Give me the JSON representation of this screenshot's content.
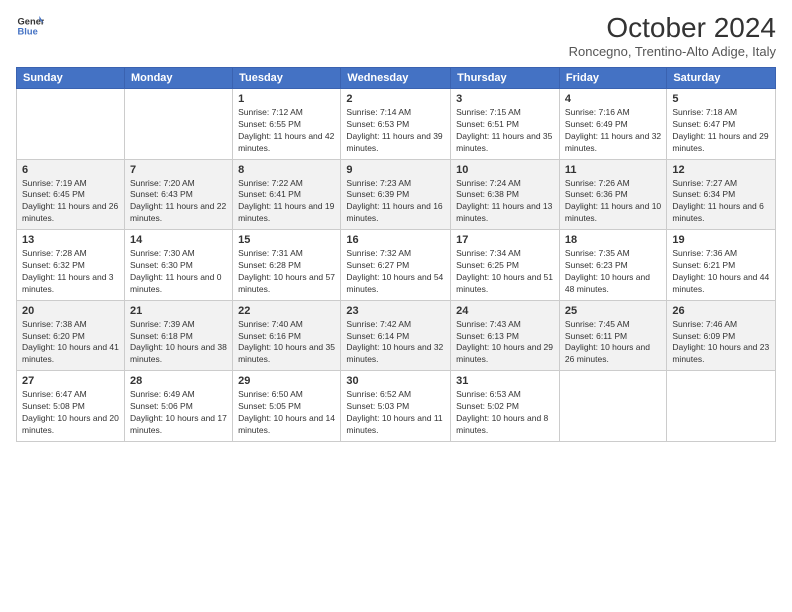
{
  "header": {
    "title": "October 2024",
    "location": "Roncegno, Trentino-Alto Adige, Italy",
    "logo_line1": "General",
    "logo_line2": "Blue"
  },
  "days_of_week": [
    "Sunday",
    "Monday",
    "Tuesday",
    "Wednesday",
    "Thursday",
    "Friday",
    "Saturday"
  ],
  "weeks": [
    [
      {
        "day": "",
        "sunrise": "",
        "sunset": "",
        "daylight": ""
      },
      {
        "day": "",
        "sunrise": "",
        "sunset": "",
        "daylight": ""
      },
      {
        "day": "1",
        "sunrise": "Sunrise: 7:12 AM",
        "sunset": "Sunset: 6:55 PM",
        "daylight": "Daylight: 11 hours and 42 minutes."
      },
      {
        "day": "2",
        "sunrise": "Sunrise: 7:14 AM",
        "sunset": "Sunset: 6:53 PM",
        "daylight": "Daylight: 11 hours and 39 minutes."
      },
      {
        "day": "3",
        "sunrise": "Sunrise: 7:15 AM",
        "sunset": "Sunset: 6:51 PM",
        "daylight": "Daylight: 11 hours and 35 minutes."
      },
      {
        "day": "4",
        "sunrise": "Sunrise: 7:16 AM",
        "sunset": "Sunset: 6:49 PM",
        "daylight": "Daylight: 11 hours and 32 minutes."
      },
      {
        "day": "5",
        "sunrise": "Sunrise: 7:18 AM",
        "sunset": "Sunset: 6:47 PM",
        "daylight": "Daylight: 11 hours and 29 minutes."
      }
    ],
    [
      {
        "day": "6",
        "sunrise": "Sunrise: 7:19 AM",
        "sunset": "Sunset: 6:45 PM",
        "daylight": "Daylight: 11 hours and 26 minutes."
      },
      {
        "day": "7",
        "sunrise": "Sunrise: 7:20 AM",
        "sunset": "Sunset: 6:43 PM",
        "daylight": "Daylight: 11 hours and 22 minutes."
      },
      {
        "day": "8",
        "sunrise": "Sunrise: 7:22 AM",
        "sunset": "Sunset: 6:41 PM",
        "daylight": "Daylight: 11 hours and 19 minutes."
      },
      {
        "day": "9",
        "sunrise": "Sunrise: 7:23 AM",
        "sunset": "Sunset: 6:39 PM",
        "daylight": "Daylight: 11 hours and 16 minutes."
      },
      {
        "day": "10",
        "sunrise": "Sunrise: 7:24 AM",
        "sunset": "Sunset: 6:38 PM",
        "daylight": "Daylight: 11 hours and 13 minutes."
      },
      {
        "day": "11",
        "sunrise": "Sunrise: 7:26 AM",
        "sunset": "Sunset: 6:36 PM",
        "daylight": "Daylight: 11 hours and 10 minutes."
      },
      {
        "day": "12",
        "sunrise": "Sunrise: 7:27 AM",
        "sunset": "Sunset: 6:34 PM",
        "daylight": "Daylight: 11 hours and 6 minutes."
      }
    ],
    [
      {
        "day": "13",
        "sunrise": "Sunrise: 7:28 AM",
        "sunset": "Sunset: 6:32 PM",
        "daylight": "Daylight: 11 hours and 3 minutes."
      },
      {
        "day": "14",
        "sunrise": "Sunrise: 7:30 AM",
        "sunset": "Sunset: 6:30 PM",
        "daylight": "Daylight: 11 hours and 0 minutes."
      },
      {
        "day": "15",
        "sunrise": "Sunrise: 7:31 AM",
        "sunset": "Sunset: 6:28 PM",
        "daylight": "Daylight: 10 hours and 57 minutes."
      },
      {
        "day": "16",
        "sunrise": "Sunrise: 7:32 AM",
        "sunset": "Sunset: 6:27 PM",
        "daylight": "Daylight: 10 hours and 54 minutes."
      },
      {
        "day": "17",
        "sunrise": "Sunrise: 7:34 AM",
        "sunset": "Sunset: 6:25 PM",
        "daylight": "Daylight: 10 hours and 51 minutes."
      },
      {
        "day": "18",
        "sunrise": "Sunrise: 7:35 AM",
        "sunset": "Sunset: 6:23 PM",
        "daylight": "Daylight: 10 hours and 48 minutes."
      },
      {
        "day": "19",
        "sunrise": "Sunrise: 7:36 AM",
        "sunset": "Sunset: 6:21 PM",
        "daylight": "Daylight: 10 hours and 44 minutes."
      }
    ],
    [
      {
        "day": "20",
        "sunrise": "Sunrise: 7:38 AM",
        "sunset": "Sunset: 6:20 PM",
        "daylight": "Daylight: 10 hours and 41 minutes."
      },
      {
        "day": "21",
        "sunrise": "Sunrise: 7:39 AM",
        "sunset": "Sunset: 6:18 PM",
        "daylight": "Daylight: 10 hours and 38 minutes."
      },
      {
        "day": "22",
        "sunrise": "Sunrise: 7:40 AM",
        "sunset": "Sunset: 6:16 PM",
        "daylight": "Daylight: 10 hours and 35 minutes."
      },
      {
        "day": "23",
        "sunrise": "Sunrise: 7:42 AM",
        "sunset": "Sunset: 6:14 PM",
        "daylight": "Daylight: 10 hours and 32 minutes."
      },
      {
        "day": "24",
        "sunrise": "Sunrise: 7:43 AM",
        "sunset": "Sunset: 6:13 PM",
        "daylight": "Daylight: 10 hours and 29 minutes."
      },
      {
        "day": "25",
        "sunrise": "Sunrise: 7:45 AM",
        "sunset": "Sunset: 6:11 PM",
        "daylight": "Daylight: 10 hours and 26 minutes."
      },
      {
        "day": "26",
        "sunrise": "Sunrise: 7:46 AM",
        "sunset": "Sunset: 6:09 PM",
        "daylight": "Daylight: 10 hours and 23 minutes."
      }
    ],
    [
      {
        "day": "27",
        "sunrise": "Sunrise: 6:47 AM",
        "sunset": "Sunset: 5:08 PM",
        "daylight": "Daylight: 10 hours and 20 minutes."
      },
      {
        "day": "28",
        "sunrise": "Sunrise: 6:49 AM",
        "sunset": "Sunset: 5:06 PM",
        "daylight": "Daylight: 10 hours and 17 minutes."
      },
      {
        "day": "29",
        "sunrise": "Sunrise: 6:50 AM",
        "sunset": "Sunset: 5:05 PM",
        "daylight": "Daylight: 10 hours and 14 minutes."
      },
      {
        "day": "30",
        "sunrise": "Sunrise: 6:52 AM",
        "sunset": "Sunset: 5:03 PM",
        "daylight": "Daylight: 10 hours and 11 minutes."
      },
      {
        "day": "31",
        "sunrise": "Sunrise: 6:53 AM",
        "sunset": "Sunset: 5:02 PM",
        "daylight": "Daylight: 10 hours and 8 minutes."
      },
      {
        "day": "",
        "sunrise": "",
        "sunset": "",
        "daylight": ""
      },
      {
        "day": "",
        "sunrise": "",
        "sunset": "",
        "daylight": ""
      }
    ]
  ]
}
